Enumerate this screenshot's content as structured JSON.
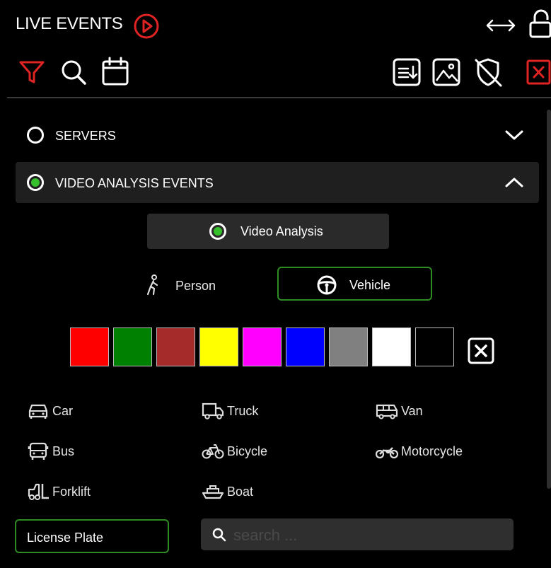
{
  "header": {
    "title": "LIVE EVENTS"
  },
  "sections": {
    "servers": {
      "label": "SERVERS",
      "selected": false,
      "expanded": false
    },
    "video_analysis_events": {
      "label": "VIDEO ANALYSIS EVENTS",
      "selected": true,
      "expanded": true
    }
  },
  "video_analysis": {
    "label": "Video Analysis",
    "selected": true
  },
  "object_types": {
    "person": {
      "label": "Person",
      "selected": false
    },
    "vehicle": {
      "label": "Vehicle",
      "selected": true
    }
  },
  "colors": [
    "#ff0000",
    "#008000",
    "#a52a2a",
    "#ffff00",
    "#ff00ff",
    "#0000ff",
    "#808080",
    "#ffffff",
    "#000000"
  ],
  "vehicle_types": [
    {
      "label": "Car",
      "icon": "car-icon"
    },
    {
      "label": "Truck",
      "icon": "truck-icon"
    },
    {
      "label": "Van",
      "icon": "van-icon"
    },
    {
      "label": "Bus",
      "icon": "bus-icon"
    },
    {
      "label": "Bicycle",
      "icon": "bicycle-icon"
    },
    {
      "label": "Motorcycle",
      "icon": "motorcycle-icon"
    },
    {
      "label": "Forklift",
      "icon": "forklift-icon"
    },
    {
      "label": "Boat",
      "icon": "boat-icon"
    }
  ],
  "license_plate": {
    "label": "License Plate"
  },
  "search": {
    "placeholder": "search ..."
  },
  "theme": {
    "accent_red": "#e02424",
    "accent_green": "#36c02b",
    "border_green": "#2e8b22"
  }
}
